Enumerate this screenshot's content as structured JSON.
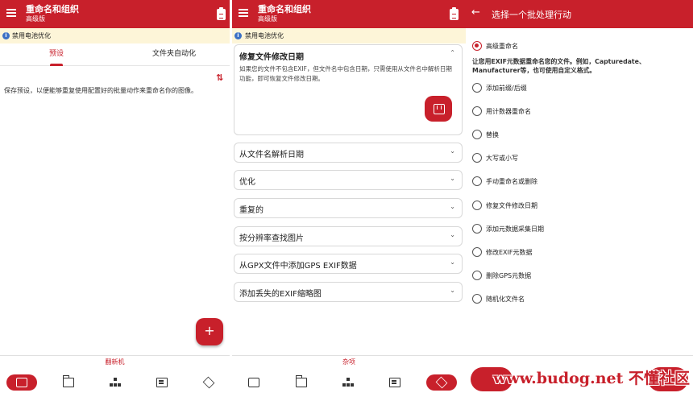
{
  "colors": {
    "brand": "#c8202b",
    "banner_bg": "#fdf5d8",
    "info": "#3b70c5"
  },
  "app": {
    "title": "重命名和组织",
    "subtitle": "高级版"
  },
  "banner": {
    "text": "禁用电池优化"
  },
  "panel1": {
    "tabs": [
      {
        "label": "预设"
      },
      {
        "label": "文件夹自动化"
      }
    ],
    "description": "保存预设，以便能够重复使用配置好的批量动作来重命名你的图像。",
    "bottom_label": "翻新机"
  },
  "panel2": {
    "expanded_card": {
      "title": "修复文件修改日期",
      "description": "如果您的文件不包含EXIF，但文件名中包含日期，只需使用从文件名中解析日期功能，即可恢复文件修改日期。"
    },
    "cards": [
      {
        "title": "从文件名解析日期"
      },
      {
        "title": "优化"
      },
      {
        "title": "重复的"
      },
      {
        "title": "按分辨率查找图片"
      },
      {
        "title": "从GPX文件中添加GPS EXIF数据"
      },
      {
        "title": "添加丢失的EXIF缩略图"
      }
    ],
    "bottom_label": "杂项"
  },
  "panel3": {
    "title": "选择一个批处理行动",
    "options": [
      {
        "label": "高级重命名",
        "selected": true
      },
      {
        "label": "添加前缀/后缀"
      },
      {
        "label": "用计数器重命名"
      },
      {
        "label": "替换"
      },
      {
        "label": "大写或小写"
      },
      {
        "label": "手动重命名或删除"
      },
      {
        "label": "修复文件修改日期"
      },
      {
        "label": "添加元数据采集日期"
      },
      {
        "label": "修改EXIF元数据"
      },
      {
        "label": "删除GPS元数据"
      },
      {
        "label": "随机化文件名"
      }
    ],
    "selected_description": "让您用EXIF元数据重命名您的文件。例如，Capturedate、Manufacturer等，也可使用自定义格式。",
    "watermark": "www.budog.net 不懂社区"
  },
  "icons": {
    "menu": "menu-icon",
    "clipboard": "clipboard-icon",
    "info": "info-icon",
    "sort": "sort-icon",
    "add": "add-icon",
    "chevron_up": "chevron-up-icon",
    "chevron_down": "chevron-down-icon",
    "back": "arrow-back-icon",
    "nav": [
      "phone-icon",
      "folder-icon",
      "tree-icon",
      "edit-list-icon",
      "box-icon"
    ]
  }
}
